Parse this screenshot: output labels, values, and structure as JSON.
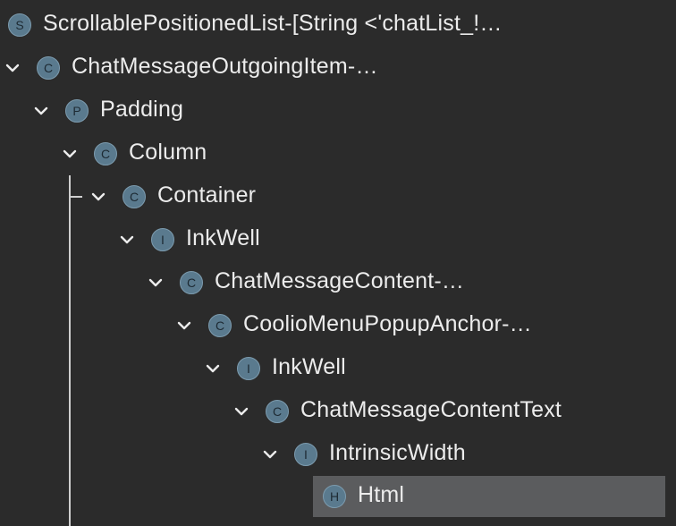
{
  "tree": {
    "rows": [
      {
        "badge": "S",
        "label": "ScrollablePositionedList-[String <'chatList_!…",
        "expanded": null,
        "selected": false
      },
      {
        "badge": "C",
        "label": "ChatMessageOutgoingItem-…",
        "expanded": true,
        "selected": false
      },
      {
        "badge": "P",
        "label": "Padding",
        "expanded": true,
        "selected": false
      },
      {
        "badge": "C",
        "label": "Column",
        "expanded": true,
        "selected": false
      },
      {
        "badge": "C",
        "label": "Container",
        "expanded": true,
        "selected": false
      },
      {
        "badge": "I",
        "label": "InkWell",
        "expanded": true,
        "selected": false
      },
      {
        "badge": "C",
        "label": "ChatMessageContent-…",
        "expanded": true,
        "selected": false
      },
      {
        "badge": "C",
        "label": "CoolioMenuPopupAnchor-…",
        "expanded": true,
        "selected": false
      },
      {
        "badge": "I",
        "label": "InkWell",
        "expanded": true,
        "selected": false
      },
      {
        "badge": "C",
        "label": "ChatMessageContentText",
        "expanded": true,
        "selected": false
      },
      {
        "badge": "I",
        "label": "IntrinsicWidth",
        "expanded": true,
        "selected": false
      },
      {
        "badge": "H",
        "label": "Html",
        "expanded": null,
        "selected": true
      }
    ]
  },
  "colors": {
    "background": "#2b2b2b",
    "text": "#ececec",
    "badge_fill": "#5a7a8e",
    "selection": "#5b5c5e",
    "guide_line": "#cfcfcf"
  }
}
